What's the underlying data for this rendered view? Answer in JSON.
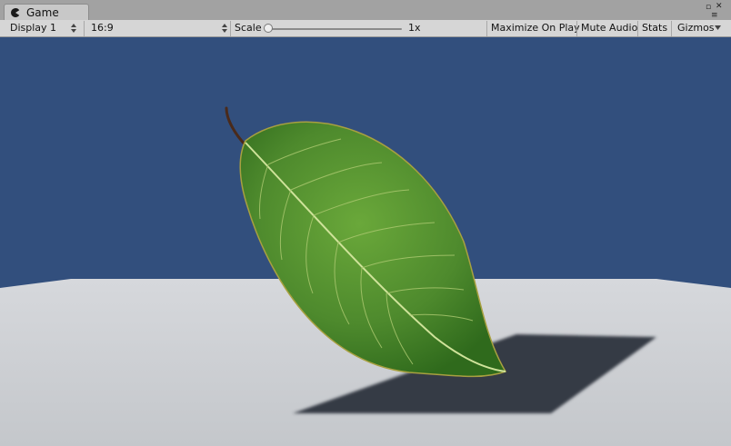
{
  "tab": {
    "title": "Game",
    "icon": "pacman-icon"
  },
  "window_controls": {
    "maximize": "▫",
    "close": "✕",
    "menu": "≡"
  },
  "toolbar": {
    "display": "Display 1",
    "aspect": "16:9",
    "scale_label": "Scale",
    "scale_value": "1x",
    "scale_level": 0,
    "maximize_on_play": "Maximize On Play",
    "mute_audio": "Mute Audio",
    "stats": "Stats",
    "gizmos": "Gizmos"
  },
  "colors": {
    "sky": "#324f7d",
    "floor": "#cdd0d4",
    "shadow": "#363a44",
    "leaf_base": "#4e8a2d",
    "leaf_vein": "#cfe39a",
    "stem": "#4a2a1a"
  }
}
